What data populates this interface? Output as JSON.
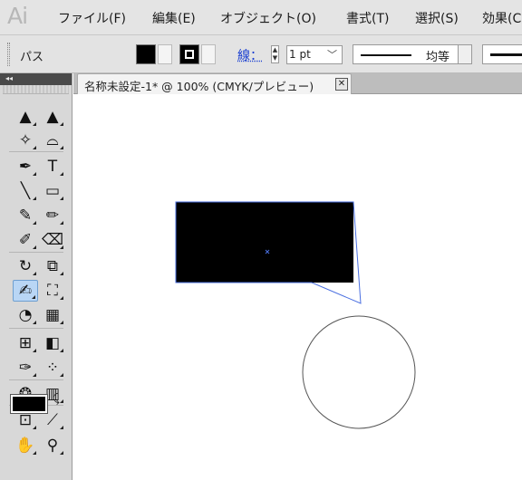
{
  "app": {
    "logo": "Ai"
  },
  "menu": {
    "items": [
      "ファイル(F)",
      "編集(E)",
      "オブジェクト(O)",
      "書式(T)",
      "選択(S)",
      "効果(C"
    ]
  },
  "control_bar": {
    "selection_label": "パス",
    "stroke_label": "線：",
    "stroke_weight": "1 pt",
    "profile_label": "均等",
    "colors": {
      "fill": "#000000",
      "stroke": "#000000",
      "link": "#1a3fd1"
    }
  },
  "tools_panel": {
    "collapse_glyph": "◂◂",
    "selected_tool": "speech-bubble-tool",
    "tools": [
      {
        "name": "selection-tool",
        "glyph": "▲"
      },
      {
        "name": "direct-selection-tool",
        "glyph": "▲"
      },
      {
        "name": "magic-wand-tool",
        "glyph": "✧"
      },
      {
        "name": "lasso-tool",
        "glyph": "⌓"
      },
      {
        "name": "pen-tool",
        "glyph": "✒"
      },
      {
        "name": "type-tool",
        "glyph": "T"
      },
      {
        "name": "line-segment-tool",
        "glyph": "╲"
      },
      {
        "name": "rectangle-tool",
        "glyph": "▭"
      },
      {
        "name": "paintbrush-tool",
        "glyph": "✎"
      },
      {
        "name": "pencil-tool",
        "glyph": "✏"
      },
      {
        "name": "blob-brush-tool",
        "glyph": "✐"
      },
      {
        "name": "eraser-tool",
        "glyph": "⌫"
      },
      {
        "name": "rotate-tool",
        "glyph": "↻"
      },
      {
        "name": "scale-tool",
        "glyph": "⧉"
      },
      {
        "name": "speech-bubble-tool",
        "glyph": "✍"
      },
      {
        "name": "free-transform-tool",
        "glyph": "⛶"
      },
      {
        "name": "shape-builder-tool",
        "glyph": "◔"
      },
      {
        "name": "perspective-grid-tool",
        "glyph": "▦"
      },
      {
        "name": "mesh-tool",
        "glyph": "⊞"
      },
      {
        "name": "gradient-tool",
        "glyph": "◧"
      },
      {
        "name": "eyedropper-tool",
        "glyph": "✑"
      },
      {
        "name": "blend-tool",
        "glyph": "⁘"
      },
      {
        "name": "symbol-sprayer-tool",
        "glyph": "❂"
      },
      {
        "name": "column-graph-tool",
        "glyph": "▥"
      },
      {
        "name": "artboard-tool",
        "glyph": "⊡"
      },
      {
        "name": "slice-tool",
        "glyph": "⟋"
      },
      {
        "name": "hand-tool",
        "glyph": "✋"
      },
      {
        "name": "zoom-tool",
        "glyph": "⚲"
      }
    ],
    "swap_glyph": "⤹"
  },
  "document": {
    "tab_title": "名称未設定-1* @ 100% (CMYK/プレビュー)",
    "close_glyph": "✕"
  },
  "canvas_objects": {
    "callout_fill": "#000000",
    "selection_color": "#4a6fe0",
    "circle_stroke": "#555555"
  }
}
